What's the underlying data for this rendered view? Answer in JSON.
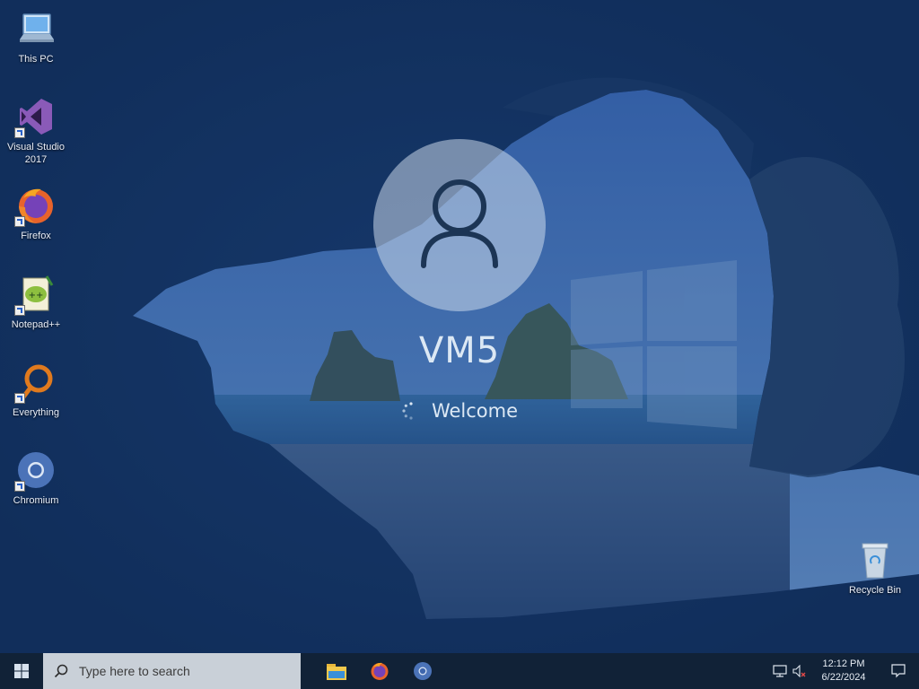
{
  "desktop": {
    "icons": [
      {
        "label": "This PC",
        "icon": "this-pc-icon"
      },
      {
        "label": "Visual Studio 2017",
        "icon": "visual-studio-icon"
      },
      {
        "label": "Firefox",
        "icon": "firefox-icon"
      },
      {
        "label": "Notepad++",
        "icon": "notepad-plus-plus-icon"
      },
      {
        "label": "Everything",
        "icon": "everything-icon"
      },
      {
        "label": "Chromium",
        "icon": "chromium-icon"
      },
      {
        "label": "Recycle Bin",
        "icon": "recycle-bin-icon"
      }
    ]
  },
  "login": {
    "username": "VM5",
    "status": "Welcome",
    "avatar_icon": "user-avatar-icon",
    "spinner_icon": "loading-spinner-icon"
  },
  "taskbar": {
    "start_icon": "windows-start-icon",
    "search_placeholder": "Type here to search",
    "search_icon": "search-icon",
    "pinned_apps": [
      {
        "name": "File Explorer",
        "icon": "file-explorer-icon"
      },
      {
        "name": "Firefox",
        "icon": "firefox-icon"
      },
      {
        "name": "Chromium",
        "icon": "chromium-icon"
      }
    ],
    "tray": {
      "network_icon": "network-icon",
      "volume_icon": "volume-muted-icon",
      "time": "12:12 PM",
      "date": "6/22/2024",
      "notifications_icon": "action-center-icon"
    },
    "colors": {
      "bar": "#112237",
      "search_bg": "#c9d0d8"
    }
  }
}
